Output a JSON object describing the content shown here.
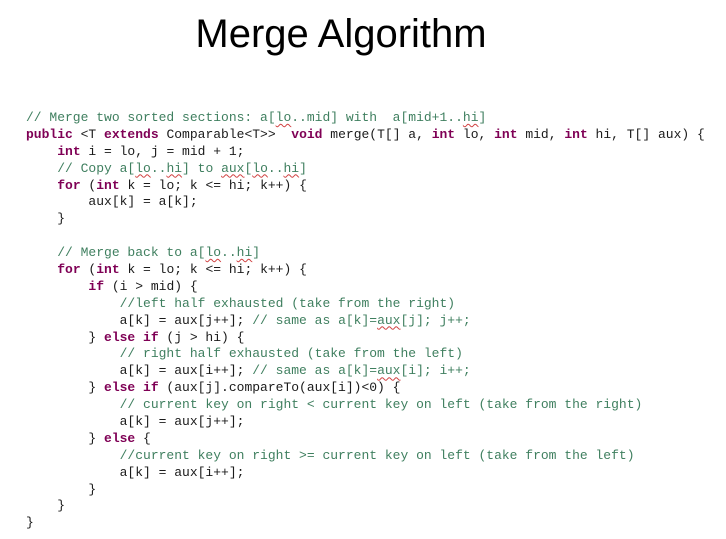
{
  "slide": {
    "title": "Merge Algorithm"
  },
  "code": {
    "language": "java",
    "colors": {
      "keyword": "#7f0055",
      "comment": "#3f7f5f",
      "text": "#1a1a1a"
    },
    "lines": [
      [
        {
          "t": "cm",
          "v": "// Merge two sorted sections: a["
        },
        {
          "t": "cm sq",
          "v": "lo"
        },
        {
          "t": "cm",
          "v": "..mid] with  a[mid+1.."
        },
        {
          "t": "cm sq",
          "v": "hi"
        },
        {
          "t": "cm",
          "v": "]"
        }
      ],
      [
        {
          "t": "kw",
          "v": "public"
        },
        {
          "t": "pl",
          "v": " <T "
        },
        {
          "t": "kw",
          "v": "extends"
        },
        {
          "t": "pl",
          "v": " Comparable<T>>  "
        },
        {
          "t": "kw",
          "v": "void"
        },
        {
          "t": "pl",
          "v": " merge(T[] a, "
        },
        {
          "t": "kw",
          "v": "int"
        },
        {
          "t": "pl",
          "v": " lo, "
        },
        {
          "t": "kw",
          "v": "int"
        },
        {
          "t": "pl",
          "v": " mid, "
        },
        {
          "t": "kw",
          "v": "int"
        },
        {
          "t": "pl",
          "v": " hi, T[] aux) {"
        }
      ],
      [
        {
          "t": "pl",
          "v": "    "
        },
        {
          "t": "kw",
          "v": "int"
        },
        {
          "t": "pl",
          "v": " i = lo, j = mid + 1;"
        }
      ],
      [
        {
          "t": "cm",
          "v": "    // Copy a["
        },
        {
          "t": "cm sq",
          "v": "lo"
        },
        {
          "t": "cm",
          "v": ".."
        },
        {
          "t": "cm sq",
          "v": "hi"
        },
        {
          "t": "cm",
          "v": "] to "
        },
        {
          "t": "cm sq",
          "v": "aux"
        },
        {
          "t": "cm",
          "v": "["
        },
        {
          "t": "cm sq",
          "v": "lo"
        },
        {
          "t": "cm",
          "v": ".."
        },
        {
          "t": "cm sq",
          "v": "hi"
        },
        {
          "t": "cm",
          "v": "]"
        }
      ],
      [
        {
          "t": "pl",
          "v": "    "
        },
        {
          "t": "kw",
          "v": "for"
        },
        {
          "t": "pl",
          "v": " ("
        },
        {
          "t": "kw",
          "v": "int"
        },
        {
          "t": "pl",
          "v": " k = lo; k <= hi; k++) {"
        }
      ],
      [
        {
          "t": "pl",
          "v": "        aux[k] = a[k];"
        }
      ],
      [
        {
          "t": "pl",
          "v": "    }"
        }
      ],
      [
        {
          "t": "pl",
          "v": ""
        }
      ],
      [
        {
          "t": "cm",
          "v": "    // Merge back to a["
        },
        {
          "t": "cm sq",
          "v": "lo"
        },
        {
          "t": "cm",
          "v": ".."
        },
        {
          "t": "cm sq",
          "v": "hi"
        },
        {
          "t": "cm",
          "v": "]"
        }
      ],
      [
        {
          "t": "pl",
          "v": "    "
        },
        {
          "t": "kw",
          "v": "for"
        },
        {
          "t": "pl",
          "v": " ("
        },
        {
          "t": "kw",
          "v": "int"
        },
        {
          "t": "pl",
          "v": " k = lo; k <= hi; k++) {"
        }
      ],
      [
        {
          "t": "pl",
          "v": "        "
        },
        {
          "t": "kw",
          "v": "if"
        },
        {
          "t": "pl",
          "v": " (i > mid) {"
        }
      ],
      [
        {
          "t": "cm",
          "v": "            //left half exhausted (take from the right)"
        }
      ],
      [
        {
          "t": "pl",
          "v": "            a[k] = aux[j++]; "
        },
        {
          "t": "cm",
          "v": "// same as a[k]="
        },
        {
          "t": "cm sq",
          "v": "aux"
        },
        {
          "t": "cm",
          "v": "[j]; j++;"
        }
      ],
      [
        {
          "t": "pl",
          "v": "        } "
        },
        {
          "t": "kw",
          "v": "else if"
        },
        {
          "t": "pl",
          "v": " (j > hi) {"
        }
      ],
      [
        {
          "t": "cm",
          "v": "            // right half exhausted (take from the left)"
        }
      ],
      [
        {
          "t": "pl",
          "v": "            a[k] = aux[i++]; "
        },
        {
          "t": "cm",
          "v": "// same as a[k]="
        },
        {
          "t": "cm sq",
          "v": "aux"
        },
        {
          "t": "cm",
          "v": "[i]; i++;"
        }
      ],
      [
        {
          "t": "pl",
          "v": "        } "
        },
        {
          "t": "kw",
          "v": "else if"
        },
        {
          "t": "pl",
          "v": " (aux[j].compareTo(aux[i])<0) {"
        }
      ],
      [
        {
          "t": "cm",
          "v": "            // current key on right < current key on left (take from the right)"
        }
      ],
      [
        {
          "t": "pl",
          "v": "            a[k] = aux[j++];"
        }
      ],
      [
        {
          "t": "pl",
          "v": "        } "
        },
        {
          "t": "kw",
          "v": "else"
        },
        {
          "t": "pl",
          "v": " {"
        }
      ],
      [
        {
          "t": "cm",
          "v": "            //current key on right >= current key on left (take from the left)"
        }
      ],
      [
        {
          "t": "pl",
          "v": "            a[k] = aux[i++];"
        }
      ],
      [
        {
          "t": "pl",
          "v": "        }"
        }
      ],
      [
        {
          "t": "pl",
          "v": "    }"
        }
      ],
      [
        {
          "t": "pl",
          "v": "}"
        }
      ]
    ]
  }
}
